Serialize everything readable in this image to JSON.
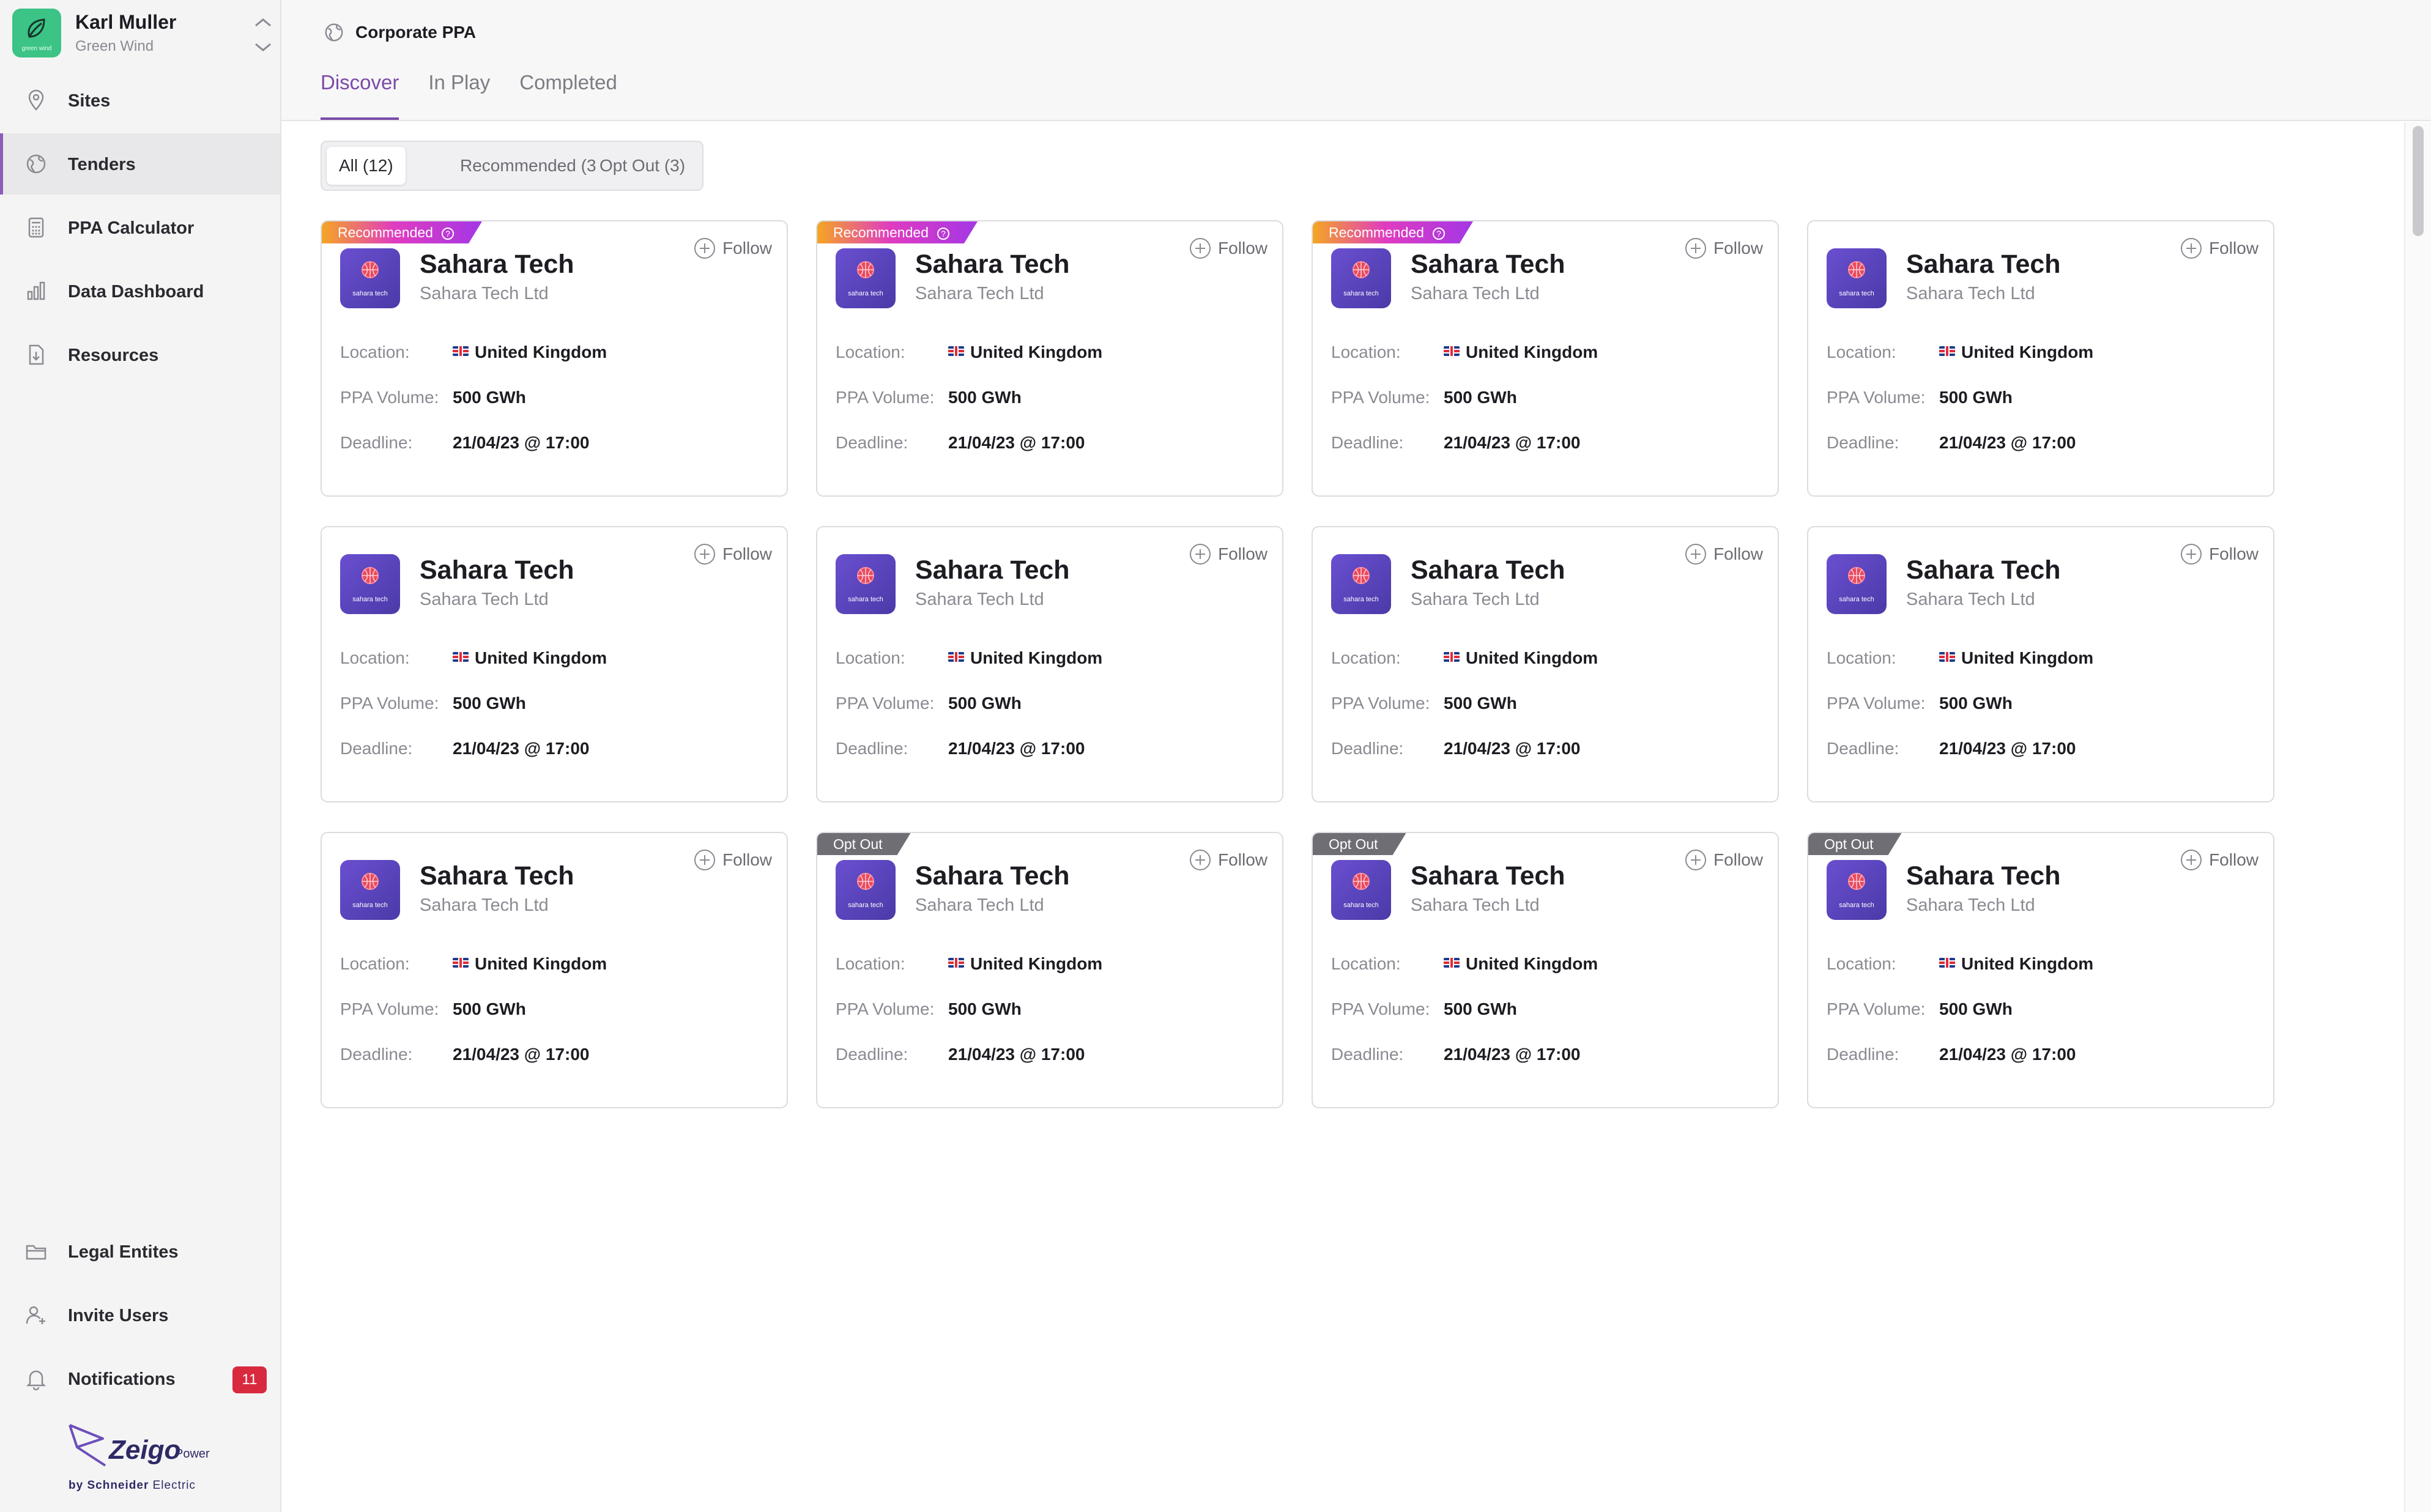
{
  "profile": {
    "name": "Karl Muller",
    "org": "Green Wind",
    "logo_caption": "green wind"
  },
  "nav": {
    "sites": "Sites",
    "tenders": "Tenders",
    "ppa_calculator": "PPA Calculator",
    "data_dashboard": "Data Dashboard",
    "resources": "Resources",
    "legal_entities": "Legal Entites",
    "invite_users": "Invite Users",
    "notifications": "Notifications",
    "notifications_count": "11"
  },
  "brand": {
    "name": "Zeigo",
    "sub": "Power",
    "by_prefix": "by",
    "by_company": "Schneider",
    "by_suffix": "Electric"
  },
  "header": {
    "breadcrumb": "Corporate PPA",
    "tabs": [
      "Discover",
      "In Play",
      "Completed"
    ],
    "active_tab": "Discover"
  },
  "filters": {
    "all": "All (12)",
    "recommended": "Recommended (3",
    "opt_out": "Opt Out (3)"
  },
  "card_labels": {
    "location": "Location:",
    "volume": "PPA Volume:",
    "deadline": "Deadline:",
    "follow": "Follow",
    "recommended": "Recommended",
    "opt_out": "Opt Out",
    "avatar_caption": "sahara tech"
  },
  "cards": [
    {
      "name": "Sahara Tech",
      "company": "Sahara Tech Ltd",
      "location": "United Kingdom",
      "volume": "500 GWh",
      "deadline": "21/04/23 @ 17:00",
      "tag": "recommended"
    },
    {
      "name": "Sahara Tech",
      "company": "Sahara Tech Ltd",
      "location": "United Kingdom",
      "volume": "500 GWh",
      "deadline": "21/04/23 @ 17:00",
      "tag": "recommended"
    },
    {
      "name": "Sahara Tech",
      "company": "Sahara Tech Ltd",
      "location": "United Kingdom",
      "volume": "500 GWh",
      "deadline": "21/04/23 @ 17:00",
      "tag": "recommended"
    },
    {
      "name": "Sahara Tech",
      "company": "Sahara Tech Ltd",
      "location": "United Kingdom",
      "volume": "500 GWh",
      "deadline": "21/04/23 @ 17:00",
      "tag": ""
    },
    {
      "name": "Sahara Tech",
      "company": "Sahara Tech Ltd",
      "location": "United Kingdom",
      "volume": "500 GWh",
      "deadline": "21/04/23 @ 17:00",
      "tag": ""
    },
    {
      "name": "Sahara Tech",
      "company": "Sahara Tech Ltd",
      "location": "United Kingdom",
      "volume": "500 GWh",
      "deadline": "21/04/23 @ 17:00",
      "tag": ""
    },
    {
      "name": "Sahara Tech",
      "company": "Sahara Tech Ltd",
      "location": "United Kingdom",
      "volume": "500 GWh",
      "deadline": "21/04/23 @ 17:00",
      "tag": ""
    },
    {
      "name": "Sahara Tech",
      "company": "Sahara Tech Ltd",
      "location": "United Kingdom",
      "volume": "500 GWh",
      "deadline": "21/04/23 @ 17:00",
      "tag": ""
    },
    {
      "name": "Sahara Tech",
      "company": "Sahara Tech Ltd",
      "location": "United Kingdom",
      "volume": "500 GWh",
      "deadline": "21/04/23 @ 17:00",
      "tag": ""
    },
    {
      "name": "Sahara Tech",
      "company": "Sahara Tech Ltd",
      "location": "United Kingdom",
      "volume": "500 GWh",
      "deadline": "21/04/23 @ 17:00",
      "tag": "opt_out"
    },
    {
      "name": "Sahara Tech",
      "company": "Sahara Tech Ltd",
      "location": "United Kingdom",
      "volume": "500 GWh",
      "deadline": "21/04/23 @ 17:00",
      "tag": "opt_out"
    },
    {
      "name": "Sahara Tech",
      "company": "Sahara Tech Ltd",
      "location": "United Kingdom",
      "volume": "500 GWh",
      "deadline": "21/04/23 @ 17:00",
      "tag": "opt_out"
    }
  ],
  "colors": {
    "accent": "#7b4aa8",
    "org_logo": "#3cc386",
    "badge": "#d9293f"
  }
}
